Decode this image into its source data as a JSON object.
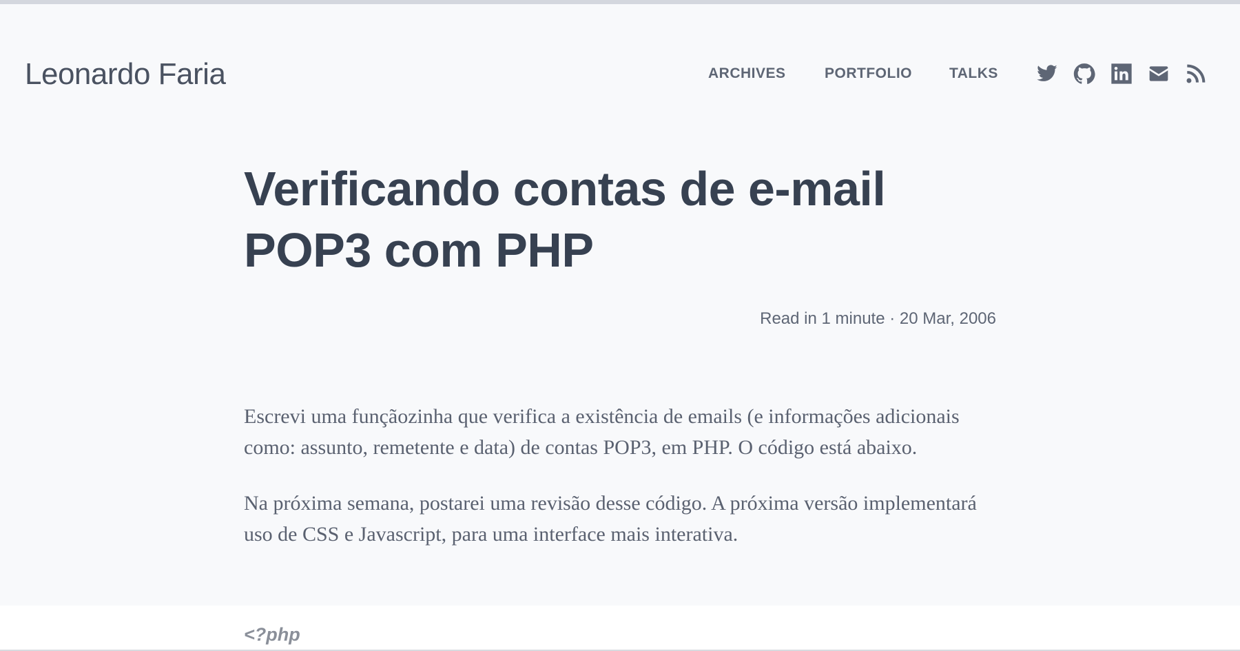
{
  "site": {
    "title": "Leonardo Faria"
  },
  "nav": {
    "archives": "ARCHIVES",
    "portfolio": "PORTFOLIO",
    "talks": "TALKS"
  },
  "social": [
    {
      "name": "twitter-icon"
    },
    {
      "name": "github-icon"
    },
    {
      "name": "linkedin-icon"
    },
    {
      "name": "email-icon"
    },
    {
      "name": "rss-icon"
    }
  ],
  "post": {
    "title": "Verificando contas de e-mail POP3 com PHP",
    "meta": "Read in 1 minute · 20 Mar, 2006",
    "paragraphs": [
      "Escrevi uma funçãozinha que verifica a existência de emails (e informações adicionais como: assunto, remetente e data) de contas POP3, em PHP. O código está abaixo.",
      "Na próxima semana, postarei uma revisão desse código. A próxima versão implementará uso de CSS e Javascript, para uma interface mais interativa."
    ],
    "code_first_line": "<?php"
  },
  "colors": {
    "page_background": "#f8f9fb",
    "title_text": "#374151",
    "nav_text": "#5e6675",
    "body_text": "#5a6170",
    "code_background": "#ffffff",
    "code_text": "#8a8f99"
  }
}
